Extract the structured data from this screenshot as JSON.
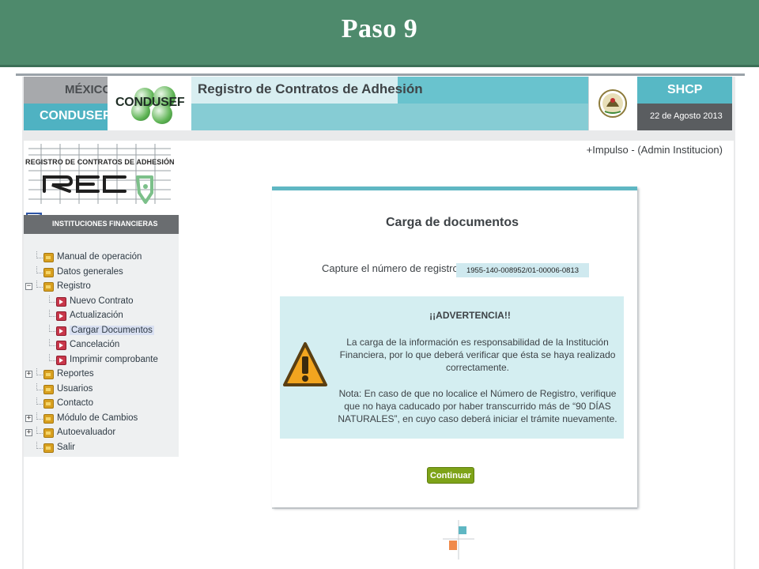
{
  "slide": {
    "title": "Paso 9"
  },
  "header": {
    "mexico": "MÉXICO",
    "condusef": "CONDUSEF",
    "condusef_logo_text": "CONDUSEF",
    "app_title": "Registro de Contratos de Adhesión",
    "shcp": "SHCP",
    "date": "22 de Agosto 2013"
  },
  "user": {
    "line": "+Impulso  -   (Admin Institucion)"
  },
  "reca_logo": {
    "top_text": "REGISTRO DE CONTRATOS DE ADHESIÓN",
    "word": "RECA"
  },
  "sidebar": {
    "section_title": "INSTITUCIONES FINANCIERAS",
    "items": [
      {
        "label": "Manual de operación",
        "level": 1,
        "icon": "folder-icon",
        "expander": ""
      },
      {
        "label": "Datos generales",
        "level": 1,
        "icon": "folder-icon",
        "expander": ""
      },
      {
        "label": "Registro",
        "level": 1,
        "icon": "folder-icon",
        "expander": "−"
      },
      {
        "label": "Nuevo Contrato",
        "level": 2,
        "icon": "page-icon",
        "expander": ""
      },
      {
        "label": "Actualización",
        "level": 2,
        "icon": "page-icon",
        "expander": ""
      },
      {
        "label": "Cargar Documentos",
        "level": 2,
        "icon": "page-icon",
        "expander": "",
        "selected": true
      },
      {
        "label": "Cancelación",
        "level": 2,
        "icon": "page-icon",
        "expander": ""
      },
      {
        "label": "Imprimir comprobante",
        "level": 2,
        "icon": "page-icon",
        "expander": ""
      },
      {
        "label": "Reportes",
        "level": 1,
        "icon": "folder-icon",
        "expander": "+"
      },
      {
        "label": "Usuarios",
        "level": 1,
        "icon": "folder-icon",
        "expander": ""
      },
      {
        "label": "Contacto",
        "level": 1,
        "icon": "folder-icon",
        "expander": ""
      },
      {
        "label": "Módulo de Cambios",
        "level": 1,
        "icon": "folder-icon",
        "expander": "+"
      },
      {
        "label": "Autoevaluador",
        "level": 1,
        "icon": "folder-icon",
        "expander": "+"
      },
      {
        "label": "Salir",
        "level": 1,
        "icon": "folder-icon",
        "expander": ""
      }
    ]
  },
  "main": {
    "title": "Carga de documentos",
    "capture_label": "Capture el número de registro:",
    "registration_number": "1955-140-008952/01-00006-0813",
    "warning": {
      "title": "¡¡ADVERTENCIA!!",
      "paragraph1": "La carga de la información es responsabilidad de la Institución Financiera, por lo que deberá verificar que ésta se haya realizado correctamente.",
      "paragraph2": "Nota: En caso de que no localice el Número de Registro, verifique que no haya caducado por haber transcurrido más de “90 DÍAS NATURALES”, en cuyo caso deberá iniciar el trámite nuevamente."
    },
    "continue_button": "Continuar"
  },
  "colors": {
    "banner": "#4e8a6c",
    "teal": "#57b8c5",
    "button_green": "#7ea318",
    "warning_bg": "#d4eef1"
  }
}
